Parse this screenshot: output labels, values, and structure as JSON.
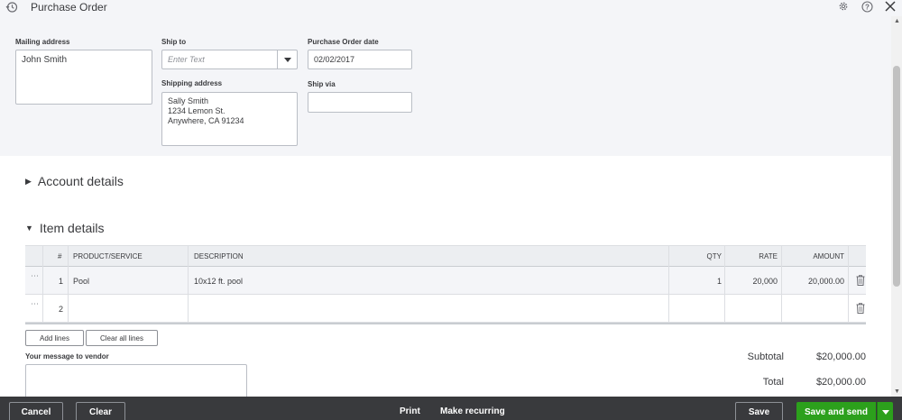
{
  "window": {
    "title": "Purchase Order"
  },
  "icons": {
    "history": "history-icon",
    "settings": "gear-icon",
    "help": "help-icon",
    "close": "close-icon"
  },
  "form": {
    "mailing_address": {
      "label": "Mailing address",
      "value": "John Smith"
    },
    "ship_to": {
      "label": "Ship to",
      "placeholder": "Enter Text"
    },
    "shipping_address": {
      "label": "Shipping address",
      "line1": "Sally Smith",
      "line2": "1234 Lemon St.",
      "line3": "Anywhere, CA 91234"
    },
    "po_date": {
      "label": "Purchase Order date",
      "value": "02/02/2017"
    },
    "ship_via": {
      "label": "Ship via",
      "value": ""
    }
  },
  "sections": {
    "account_details": "Account details",
    "item_details": "Item details"
  },
  "table": {
    "headers": {
      "num": "#",
      "product": "PRODUCT/SERVICE",
      "description": "DESCRIPTION",
      "qty": "QTY",
      "rate": "RATE",
      "amount": "AMOUNT"
    },
    "rows": [
      {
        "num": "1",
        "product": "Pool",
        "description": "10x12 ft. pool",
        "qty": "1",
        "rate": "20,000",
        "amount": "20,000.00"
      },
      {
        "num": "2",
        "product": "",
        "description": "",
        "qty": "",
        "rate": "",
        "amount": ""
      }
    ]
  },
  "actions": {
    "add_lines": "Add lines",
    "clear_all_lines": "Clear all lines"
  },
  "message": {
    "label": "Your message to vendor",
    "value": ""
  },
  "totals": {
    "subtotal_label": "Subtotal",
    "subtotal_value": "$20,000.00",
    "total_label": "Total",
    "total_value": "$20,000.00"
  },
  "footer": {
    "cancel": "Cancel",
    "clear": "Clear",
    "print": "Print",
    "make_recurring": "Make recurring",
    "save": "Save",
    "save_and_send": "Save and send"
  },
  "colors": {
    "primary_green": "#2ca01c",
    "footer_bg": "#393a3d",
    "header_bg": "#f4f5f8"
  }
}
